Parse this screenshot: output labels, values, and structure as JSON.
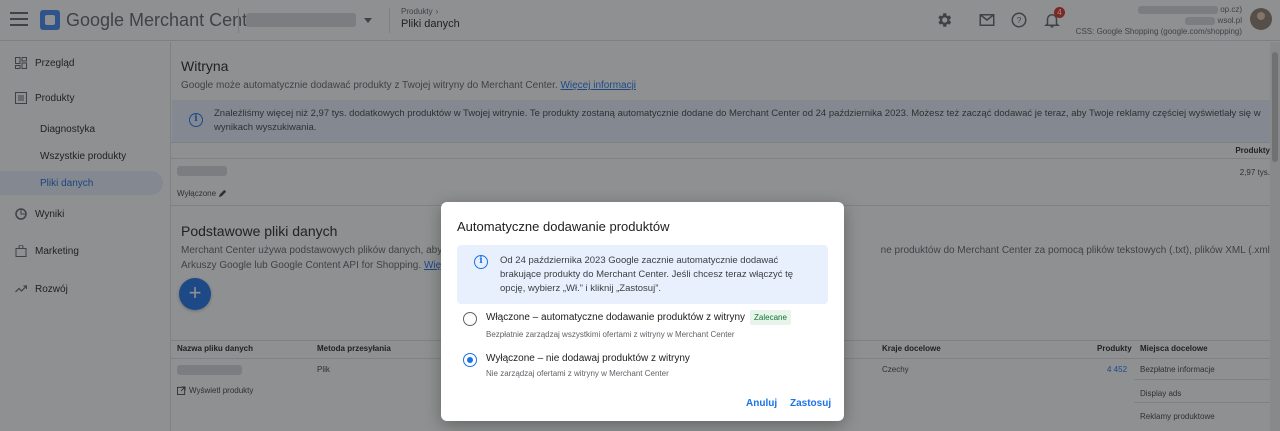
{
  "header": {
    "app_title": "Google Merchant Center",
    "breadcrumb_parent": "Produkty",
    "breadcrumb_current": "Pliki danych",
    "notification_count": "4",
    "account_line_1": "op.cz)",
    "account_line_2": "wsol.pl",
    "account_line_3": "CSS: Google Shopping (google.com/shopping)"
  },
  "sidebar": {
    "items": [
      {
        "label": "Przegląd",
        "icon": "dashboard-icon"
      },
      {
        "label": "Produkty",
        "icon": "list-icon"
      },
      {
        "label": "Diagnostyka"
      },
      {
        "label": "Wszystkie produkty"
      },
      {
        "label": "Pliki danych"
      },
      {
        "label": "Wyniki",
        "icon": "chart-icon"
      },
      {
        "label": "Marketing",
        "icon": "bag-icon"
      },
      {
        "label": "Rozwój",
        "icon": "trend-icon"
      }
    ]
  },
  "main": {
    "website_title": "Witryna",
    "website_text": "Google może automatycznie dodawać produkty z Twojej witryny do Merchant Center.",
    "website_link": "Więcej informacji",
    "banner_text": "Znaleźliśmy więcej niż 2,97 tys. dodatkowych produktów w Twojej witrynie. Te produkty zostaną automatycznie dodane do Merchant Center od 24 października 2023. Możesz też zacząć dodawać je teraz, aby Twoje reklamy częściej wyświetlały się w wynikach wyszukiwania.",
    "products_header": "Produkty",
    "products_value": "2,97 tys.",
    "status_text": "Wyłączone",
    "primary_title": "Podstawowe pliki danych",
    "primary_text_left": "Merchant Center używa podstawowych plików danych, aby",
    "primary_text_right": "ne produktów do Merchant Center za pomocą plików tekstowych (.txt), plików XML (.xml),",
    "primary_text_line2": "Arkuszy Google lub Google Content API for Shopping.",
    "primary_link": "Więc",
    "fab_label": "+",
    "table": {
      "col_name": "Nazwa pliku danych",
      "col_method": "Metoda przesyłania",
      "col_countries": "Kraje docelowe",
      "col_products": "Produkty",
      "col_destinations": "Miejsca docelowe",
      "row_method": "Plik",
      "row_countries": "Czechy",
      "row_products": "4 452",
      "row_view": "Wyświetl produkty",
      "destinations": [
        "Bezpłatne informacje",
        "Display ads",
        "Reklamy produktowe"
      ]
    }
  },
  "dialog": {
    "title": "Automatyczne dodawanie produktów",
    "info": "Od 24 października 2023 Google zacznie automatycznie dodawać brakujące produkty do Merchant Center. Jeśli chcesz teraz włączyć tę opcję, wybierz „Wł.” i kliknij „Zastosuj”.",
    "option_on_label": "Włączone – automatyczne dodawanie produktów z witryny",
    "option_on_desc": "Bezpłatnie zarządzaj wszystkimi ofertami z witryny w Merchant Center",
    "option_on_chip": "Zalecane",
    "option_off_label": "Wyłączone – nie dodawaj produktów z witryny",
    "option_off_desc": "Nie zarządzaj ofertami z witryny w Merchant Center",
    "selected": "off",
    "cancel": "Anuluj",
    "apply": "Zastosuj"
  }
}
